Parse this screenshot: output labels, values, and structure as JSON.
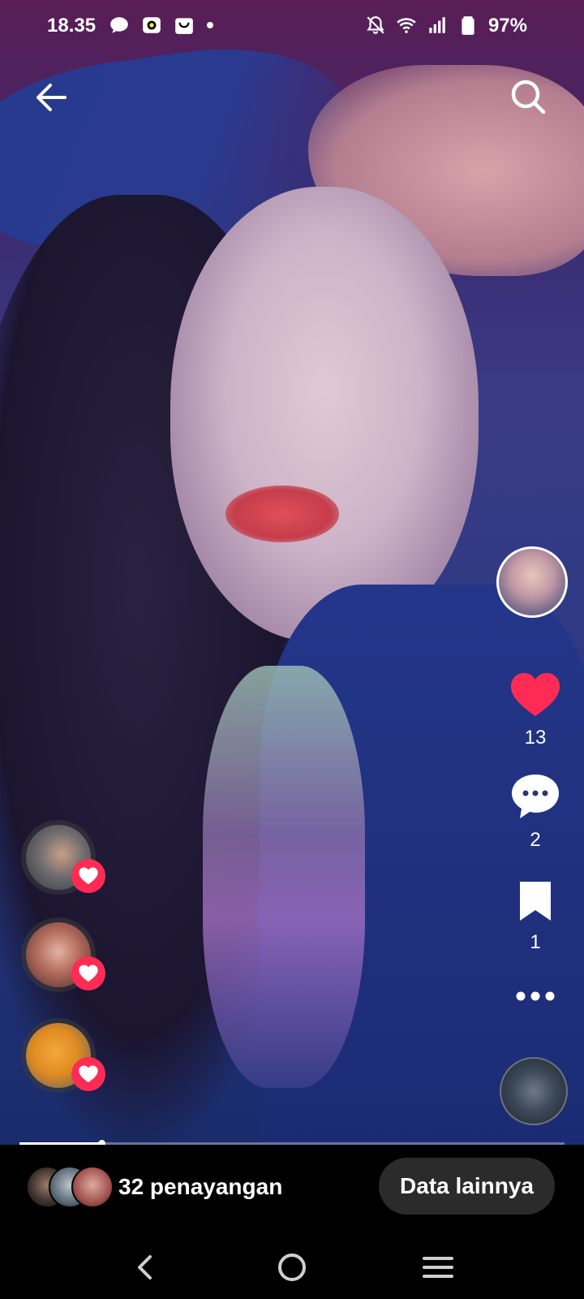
{
  "status_bar": {
    "time": "18.35",
    "battery": "97%",
    "left_icons": [
      "chat-bubble-icon",
      "app-notification-icon",
      "shopping-bag-icon",
      "dot-icon"
    ],
    "right_icons": [
      "bell-off-icon",
      "wifi-icon",
      "signal-icon",
      "battery-icon"
    ]
  },
  "top_bar": {
    "back_icon": "arrow-left-icon",
    "search_icon": "search-icon"
  },
  "actions": {
    "likes_count": "13",
    "comments_count": "2",
    "bookmarks_count": "1",
    "like_color": "#fe2c55"
  },
  "video": {
    "progress_fraction": 0.15
  },
  "bottom": {
    "views_text": "32 penayangan",
    "more_data_label": "Data lainnya"
  },
  "nav": {
    "back_icon": "nav-back-icon",
    "home_icon": "nav-home-icon",
    "menu_icon": "nav-recents-icon"
  }
}
